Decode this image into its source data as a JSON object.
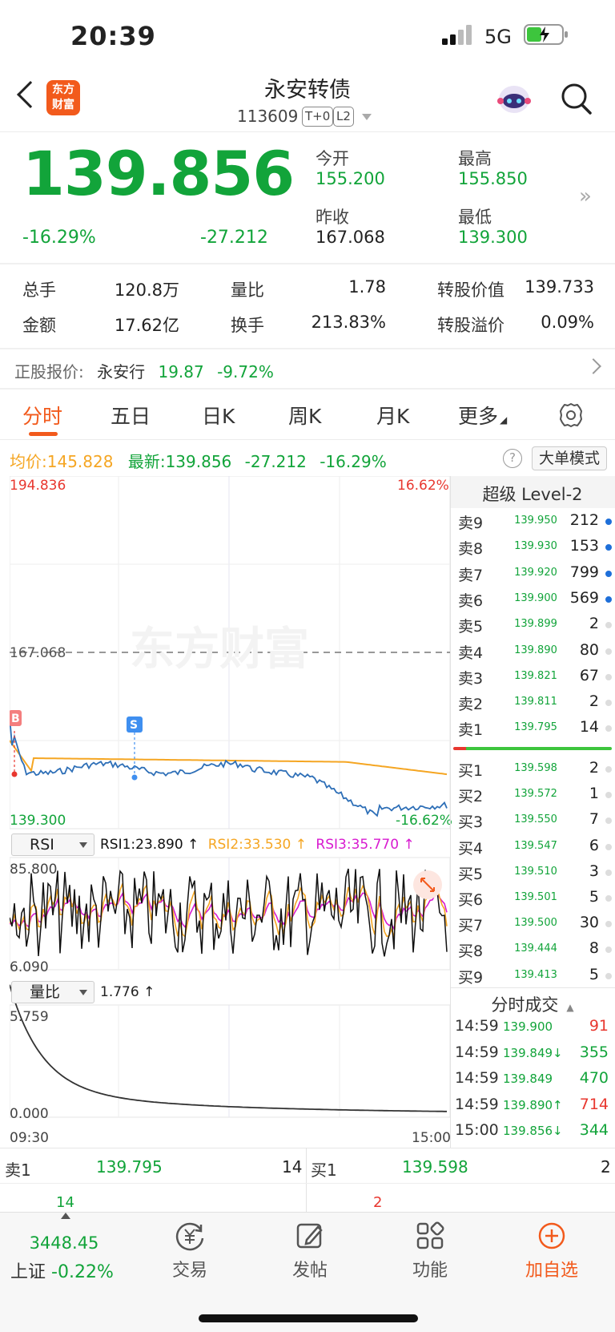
{
  "status_bar": {
    "time": "20:39",
    "network": "5G"
  },
  "header": {
    "logo_line1": "东方",
    "logo_line2": "财富",
    "stock_name": "永安转债",
    "stock_code": "113609",
    "tag_t0": "T+0",
    "tag_l2": "L2"
  },
  "quote": {
    "price": "139.856",
    "change_pct": "-16.29%",
    "change": "-27.212",
    "open_label": "今开",
    "open": "155.200",
    "high_label": "最高",
    "high": "155.850",
    "prev_close_label": "昨收",
    "prev_close": "167.068",
    "low_label": "最低",
    "low": "139.300"
  },
  "stats": {
    "volume_label": "总手",
    "volume": "120.8万",
    "vol_ratio_label": "量比",
    "vol_ratio": "1.78",
    "conv_value_label": "转股价值",
    "conv_value": "139.733",
    "amount_label": "金额",
    "amount": "17.62亿",
    "turnover_label": "换手",
    "turnover": "213.83%",
    "conv_premium_label": "转股溢价",
    "conv_premium": "0.09%"
  },
  "underlying": {
    "label": "正股报价:",
    "name": "永安行",
    "price": "19.87",
    "change_pct": "-9.72%"
  },
  "tabs": [
    "分时",
    "五日",
    "日K",
    "周K",
    "月K",
    "更多"
  ],
  "info_line": {
    "avg_label": "均价:",
    "avg": "145.828",
    "latest_label": "最新:",
    "latest": "139.856",
    "latest_chg": "-27.212",
    "latest_pct": "-16.29%",
    "help": "?",
    "big_order_mode": "大单模式"
  },
  "chart_axes": {
    "top_price": "194.836",
    "top_pct": "16.62%",
    "mid_price": "167.068",
    "bottom_price": "139.300",
    "bottom_pct": "-16.62%",
    "watermark": "东方财富",
    "buy_marker": "B",
    "sell_marker": "S"
  },
  "rsi": {
    "selector": "RSI",
    "rsi1": "RSI1:23.890 ↑",
    "rsi2": "RSI2:33.530 ↑",
    "rsi3": "RSI3:35.770 ↑",
    "max": "85.800",
    "min": "6.090",
    "colors": {
      "rsi1": "#111111",
      "rsi2": "#f5a623",
      "rsi3": "#d81bd0"
    }
  },
  "vol_ratio_panel": {
    "selector": "量比",
    "value": "1.776 ↑",
    "max": "5.759",
    "min": "0.000",
    "time_start": "09:30",
    "time_end": "15:00"
  },
  "level2": {
    "title": "超级 Level-2",
    "asks": [
      {
        "label": "卖9",
        "price": "139.950",
        "volume": "212",
        "dot": "blue"
      },
      {
        "label": "卖8",
        "price": "139.930",
        "volume": "153",
        "dot": "blue"
      },
      {
        "label": "卖7",
        "price": "139.920",
        "volume": "799",
        "dot": "blue"
      },
      {
        "label": "卖6",
        "price": "139.900",
        "volume": "569",
        "dot": "blue"
      },
      {
        "label": "卖5",
        "price": "139.899",
        "volume": "2",
        "dot": "gray"
      },
      {
        "label": "卖4",
        "price": "139.890",
        "volume": "80",
        "dot": "gray"
      },
      {
        "label": "卖3",
        "price": "139.821",
        "volume": "67",
        "dot": "gray"
      },
      {
        "label": "卖2",
        "price": "139.811",
        "volume": "2",
        "dot": "gray"
      },
      {
        "label": "卖1",
        "price": "139.795",
        "volume": "14",
        "dot": "gray"
      }
    ],
    "bids": [
      {
        "label": "买1",
        "price": "139.598",
        "volume": "2"
      },
      {
        "label": "买2",
        "price": "139.572",
        "volume": "1"
      },
      {
        "label": "买3",
        "price": "139.550",
        "volume": "7"
      },
      {
        "label": "买4",
        "price": "139.547",
        "volume": "6"
      },
      {
        "label": "买5",
        "price": "139.510",
        "volume": "3"
      },
      {
        "label": "买6",
        "price": "139.501",
        "volume": "5"
      },
      {
        "label": "买7",
        "price": "139.500",
        "volume": "30"
      },
      {
        "label": "买8",
        "price": "139.444",
        "volume": "8"
      },
      {
        "label": "买9",
        "price": "139.413",
        "volume": "5"
      }
    ]
  },
  "trades": {
    "title": "分时成交",
    "rows": [
      {
        "time": "14:59",
        "price": "139.900",
        "volume": "91",
        "color": "red"
      },
      {
        "time": "14:59",
        "price": "139.849↓",
        "volume": "355",
        "color": "green"
      },
      {
        "time": "14:59",
        "price": "139.849",
        "volume": "470",
        "color": "green"
      },
      {
        "time": "14:59",
        "price": "139.890↑",
        "volume": "714",
        "color": "red"
      },
      {
        "time": "15:00",
        "price": "139.856↓",
        "volume": "344",
        "color": "green"
      }
    ]
  },
  "bottom_strip": {
    "ask_label": "卖1",
    "ask_price": "139.795",
    "ask_vol": "14",
    "ask_sub": "14",
    "bid_label": "买1",
    "bid_price": "139.598",
    "bid_vol": "2",
    "bid_sub": "2"
  },
  "tabbar": {
    "index_value": "3448.45",
    "index_name": "上证",
    "index_pct": "-0.22%",
    "trade": "交易",
    "post": "发帖",
    "functions": "功能",
    "add_watch": "加自选"
  },
  "colors": {
    "up": "#e8372f",
    "down": "#12a43a",
    "accent": "#f25a1c",
    "price_line": "#2e6fb7",
    "avg_line": "#f5a623"
  }
}
